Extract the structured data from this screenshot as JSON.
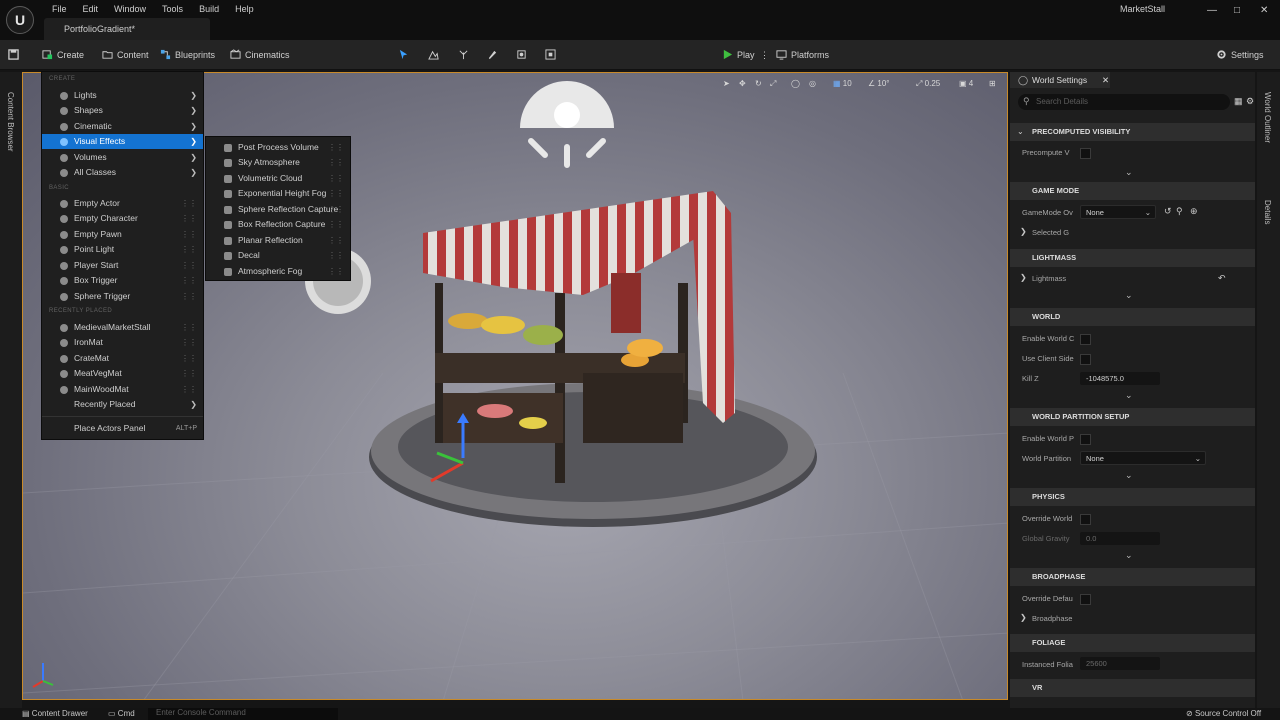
{
  "menubar": [
    "File",
    "Edit",
    "Window",
    "Tools",
    "Build",
    "Help"
  ],
  "document_tab": "PortfolioGradient*",
  "project_name": "MarketStall",
  "toolbar": {
    "create": "Create",
    "content": "Content",
    "blueprints": "Blueprints",
    "cinematics": "Cinematics",
    "play": "Play",
    "platforms": "Platforms",
    "settings": "Settings"
  },
  "viewport_toolbar": {
    "grid_snap": "10",
    "rotation_snap": "10°",
    "scale_snap": "0.25",
    "camera_speed": "4"
  },
  "left_strip": {
    "content_browser": "Content Browser"
  },
  "right_strip": {
    "world_outliner": "World Outliner",
    "details": "Details"
  },
  "create_menu": {
    "section_create": "CREATE",
    "create_items": [
      "Lights",
      "Shapes",
      "Cinematic",
      "Visual Effects",
      "Volumes",
      "All Classes"
    ],
    "section_basic": "BASIC",
    "basic_items": [
      "Empty Actor",
      "Empty Character",
      "Empty Pawn",
      "Point Light",
      "Player Start",
      "Box Trigger",
      "Sphere Trigger"
    ],
    "section_recent": "RECENTLY PLACED",
    "recent_items": [
      "MedievalMarketStall",
      "IronMat",
      "CrateMat",
      "MeatVegMat",
      "MainWoodMat",
      "Recently Placed"
    ],
    "place_actors_panel": "Place Actors Panel",
    "place_actors_shortcut": "ALT+P"
  },
  "visual_effects_menu": [
    "Post Process Volume",
    "Sky Atmosphere",
    "Volumetric Cloud",
    "Exponential Height Fog",
    "Sphere Reflection Capture",
    "Box Reflection Capture",
    "Planar Reflection",
    "Decal",
    "Atmospheric Fog"
  ],
  "world_settings": {
    "tab_title": "World Settings",
    "search_placeholder": "Search Details",
    "sections": {
      "precomputed_visibility": "PRECOMPUTED VISIBILITY",
      "game_mode": "GAME MODE",
      "lightmass": "LIGHTMASS",
      "world": "WORLD",
      "world_partition_setup": "WORLD PARTITION SETUP",
      "physics": "PHYSICS",
      "broadphase": "BROADPHASE",
      "foliage": "FOLIAGE",
      "vr": "VR"
    },
    "props": {
      "precompute_v": "Precompute V",
      "gamemode_ov": "GameMode Ov",
      "gamemode_value": "None",
      "selected_g": "Selected G",
      "lightmass": "Lightmass",
      "enable_world_c": "Enable World C",
      "use_client_side": "Use Client Side",
      "kill_z": "Kill Z",
      "kill_z_value": "-1048575.0",
      "enable_world_p": "Enable World P",
      "world_partition": "World Partition",
      "world_partition_value": "None",
      "override_world": "Override World",
      "global_gravity": "Global Gravity",
      "global_gravity_value": "0.0",
      "override_defaults": "Override Defau",
      "broadphase": "Broadphase",
      "instanced_foliage": "Instanced Folia",
      "instanced_foliage_value": "25600"
    }
  },
  "bottombar": {
    "content_drawer": "Content Drawer",
    "cmd": "Cmd",
    "console_placeholder": "Enter Console Command",
    "source_control": "Source Control Off"
  }
}
